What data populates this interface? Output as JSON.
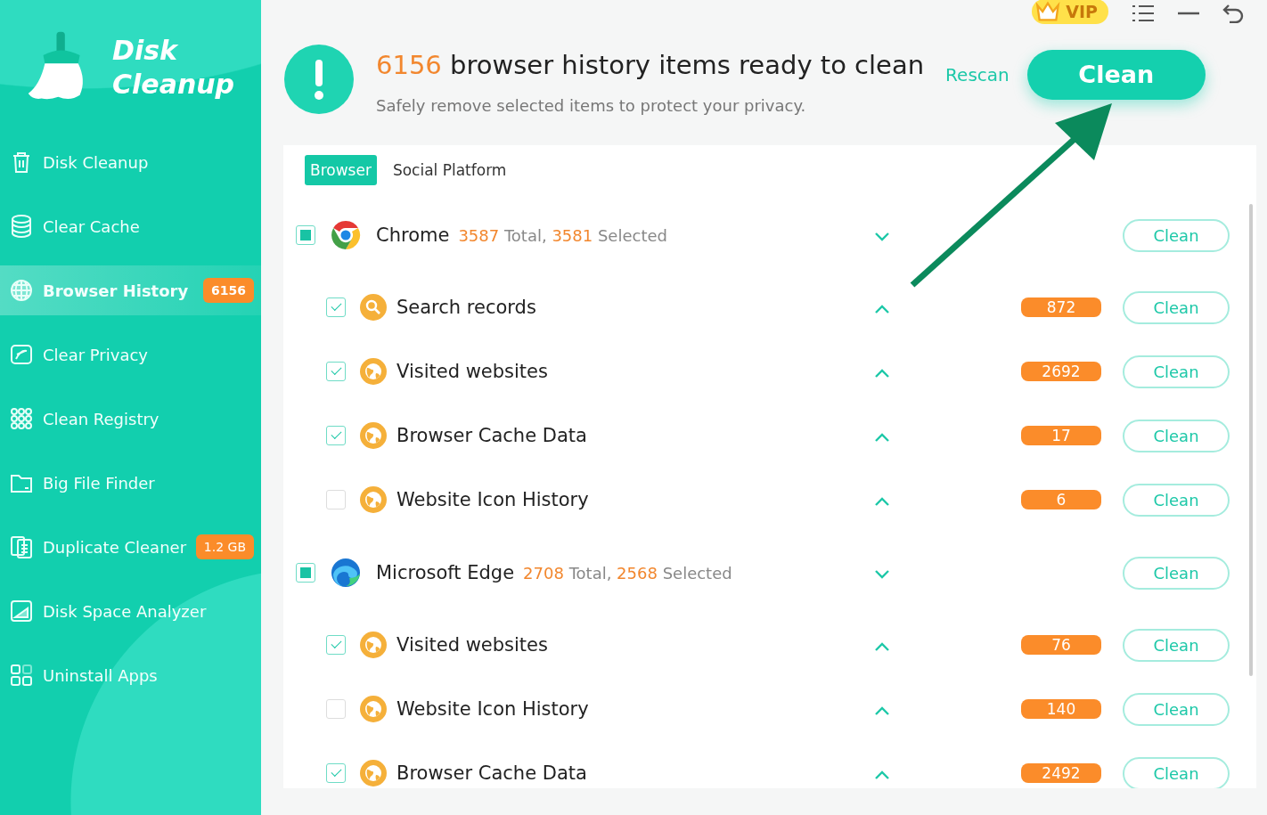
{
  "app": {
    "name_line1": "Disk",
    "name_line2": "Cleanup"
  },
  "sidebar": {
    "items": [
      {
        "label": "Disk Cleanup",
        "selected": false
      },
      {
        "label": "Clear Cache",
        "selected": false
      },
      {
        "label": "Browser History",
        "selected": true,
        "badge": "6156"
      },
      {
        "label": "Clear Privacy",
        "selected": false
      },
      {
        "label": "Clean Registry",
        "selected": false
      },
      {
        "label": "Big File Finder",
        "selected": false
      },
      {
        "label": "Duplicate Cleaner",
        "selected": false,
        "badge": "1.2 GB"
      },
      {
        "label": "Disk Space Analyzer",
        "selected": false
      },
      {
        "label": "Uninstall Apps",
        "selected": false
      }
    ]
  },
  "top_bar": {
    "vip": "VIP"
  },
  "header": {
    "count": "6156",
    "title": "browser history items ready to clean",
    "subtitle": "Safely remove selected items to protect your privacy.",
    "rescan": "Rescan",
    "clean": "Clean"
  },
  "tabs": [
    {
      "label": "Browser",
      "selected": true
    },
    {
      "label": "Social Platform",
      "selected": false
    }
  ],
  "groups": [
    {
      "name": "Chrome",
      "total": "3587",
      "total_label": "Total,",
      "selected_count": "3581",
      "selected_label": "Selected",
      "checked": true,
      "partial": true,
      "expanded": true,
      "button": "Clean",
      "items": [
        {
          "kind": "search",
          "label": "Search records",
          "checked": true,
          "expanded": false,
          "count": "872",
          "button": "Clean"
        },
        {
          "kind": "globe",
          "label": "Visited websites",
          "checked": true,
          "expanded": false,
          "count": "2692",
          "button": "Clean"
        },
        {
          "kind": "globe",
          "label": "Browser Cache Data",
          "checked": true,
          "expanded": false,
          "count": "17",
          "button": "Clean"
        },
        {
          "kind": "globe",
          "label": "Website Icon History",
          "checked": false,
          "expanded": false,
          "count": "6",
          "button": "Clean"
        }
      ]
    },
    {
      "name": "Microsoft Edge",
      "total": "2708",
      "total_label": "Total,",
      "selected_count": "2568",
      "selected_label": "Selected",
      "checked": true,
      "partial": true,
      "expanded": true,
      "button": "Clean",
      "items": [
        {
          "kind": "globe",
          "label": "Visited websites",
          "checked": true,
          "expanded": false,
          "count": "76",
          "button": "Clean"
        },
        {
          "kind": "globe",
          "label": "Website Icon History",
          "checked": false,
          "expanded": false,
          "count": "140",
          "button": "Clean"
        },
        {
          "kind": "globe",
          "label": "Browser Cache Data",
          "checked": true,
          "expanded": false,
          "count": "2492",
          "button": "Clean"
        }
      ]
    }
  ]
}
